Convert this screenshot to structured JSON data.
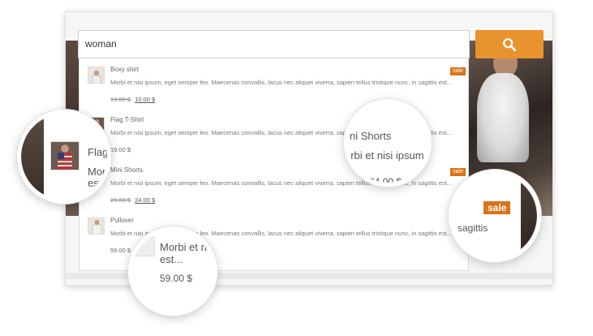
{
  "search": {
    "value": "woman"
  },
  "results": [
    {
      "name": "Boxy shirt",
      "description": "Morbi et nisi ipsum, eget semper leo. Maecenas convallis, lacus nec aliquet viverra, sapien tellus tristique nunc, in sagittis est...",
      "old_price": "19.00 $",
      "price": "10.00 $",
      "sale": "sale"
    },
    {
      "name": "Flag T-Shirt",
      "description": "Morbi et nisi ipsum, eget semper leo. Maecenas convallis, lacus nec aliquet viverra, sapien tellus tristique nunc, in sagittis est...",
      "price": "19.00 $"
    },
    {
      "name": "Mini Shorts",
      "description": "Morbi et nisi ipsum, eget semper leo. Maecenas convallis, lacus nec aliquet viverra, sapien tellus tristique nunc, in sagittis est...",
      "old_price": "29.00 $",
      "price": "24.00 $",
      "sale": "sale"
    },
    {
      "name": "Pullover",
      "description": "Morbi et nisi ipsum, eget semper leo. Maecenas convallis, lacus nec aliquet viverra, sapien tellus tristique nunc, in sagittis est...",
      "price": "59.00 $"
    }
  ],
  "zoom": {
    "flag": {
      "name_fragment": "Flag",
      "desc_fragment": "Morb",
      "desc_fragment2": "est"
    },
    "shorts": {
      "name_fragment": "ni Shorts",
      "desc_fragment": "orbi et nisi ipsum, e",
      "price_fragment": "$ 24.00 $"
    },
    "sale": {
      "badge": "sale",
      "text_fragment": "sagittis"
    },
    "pullover": {
      "desc_fragment": "Morbi et ni",
      "desc_fragment2": "est...",
      "price": "59.00 $"
    }
  },
  "icons": {
    "search_button": "search-icon"
  },
  "colors": {
    "accent": "#e8932d",
    "sale_badge": "#d9731a"
  }
}
